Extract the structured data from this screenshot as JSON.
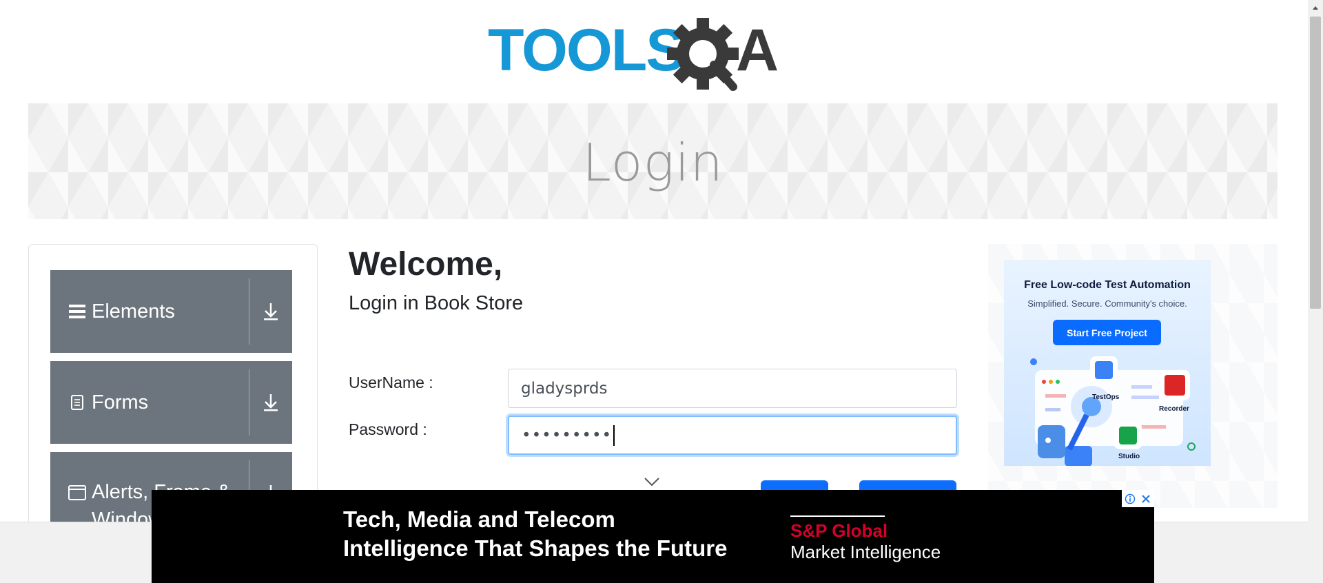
{
  "logo": {
    "text_tools": "TOOLS",
    "text_a": "A",
    "colors": {
      "tools": "#1697d6",
      "gear": "#3a3a3a"
    }
  },
  "banner": {
    "title": "Login"
  },
  "sidebar": {
    "groups": [
      {
        "label": "Elements",
        "icon": "hamburger-icon"
      },
      {
        "label": "Forms",
        "icon": "document-icon"
      },
      {
        "label": "Alerts, Frame & Windows",
        "icon": "window-icon"
      }
    ]
  },
  "form": {
    "welcome": "Welcome,",
    "subtitle": "Login in Book Store",
    "username_label": "UserName :",
    "username_value": "gladysprds",
    "password_label": "Password :",
    "password_value": "•••••••••"
  },
  "ad_right": {
    "headline": "Free Low-code Test Automation",
    "subline": "Simplified. Secure. Community's choice.",
    "cta": "Start Free Project",
    "apps": [
      "TestOps",
      "Recorder",
      "Studio"
    ]
  },
  "ad_bottom": {
    "line1": "Tech, Media and Telecom",
    "line2": "Intelligence That Shapes the Future",
    "brand1": "S&P Global",
    "brand2": "Market Intelligence"
  },
  "colors": {
    "sidebar_bg": "#6c757d",
    "primary": "#0d6efd",
    "focus": "#80bdff"
  }
}
